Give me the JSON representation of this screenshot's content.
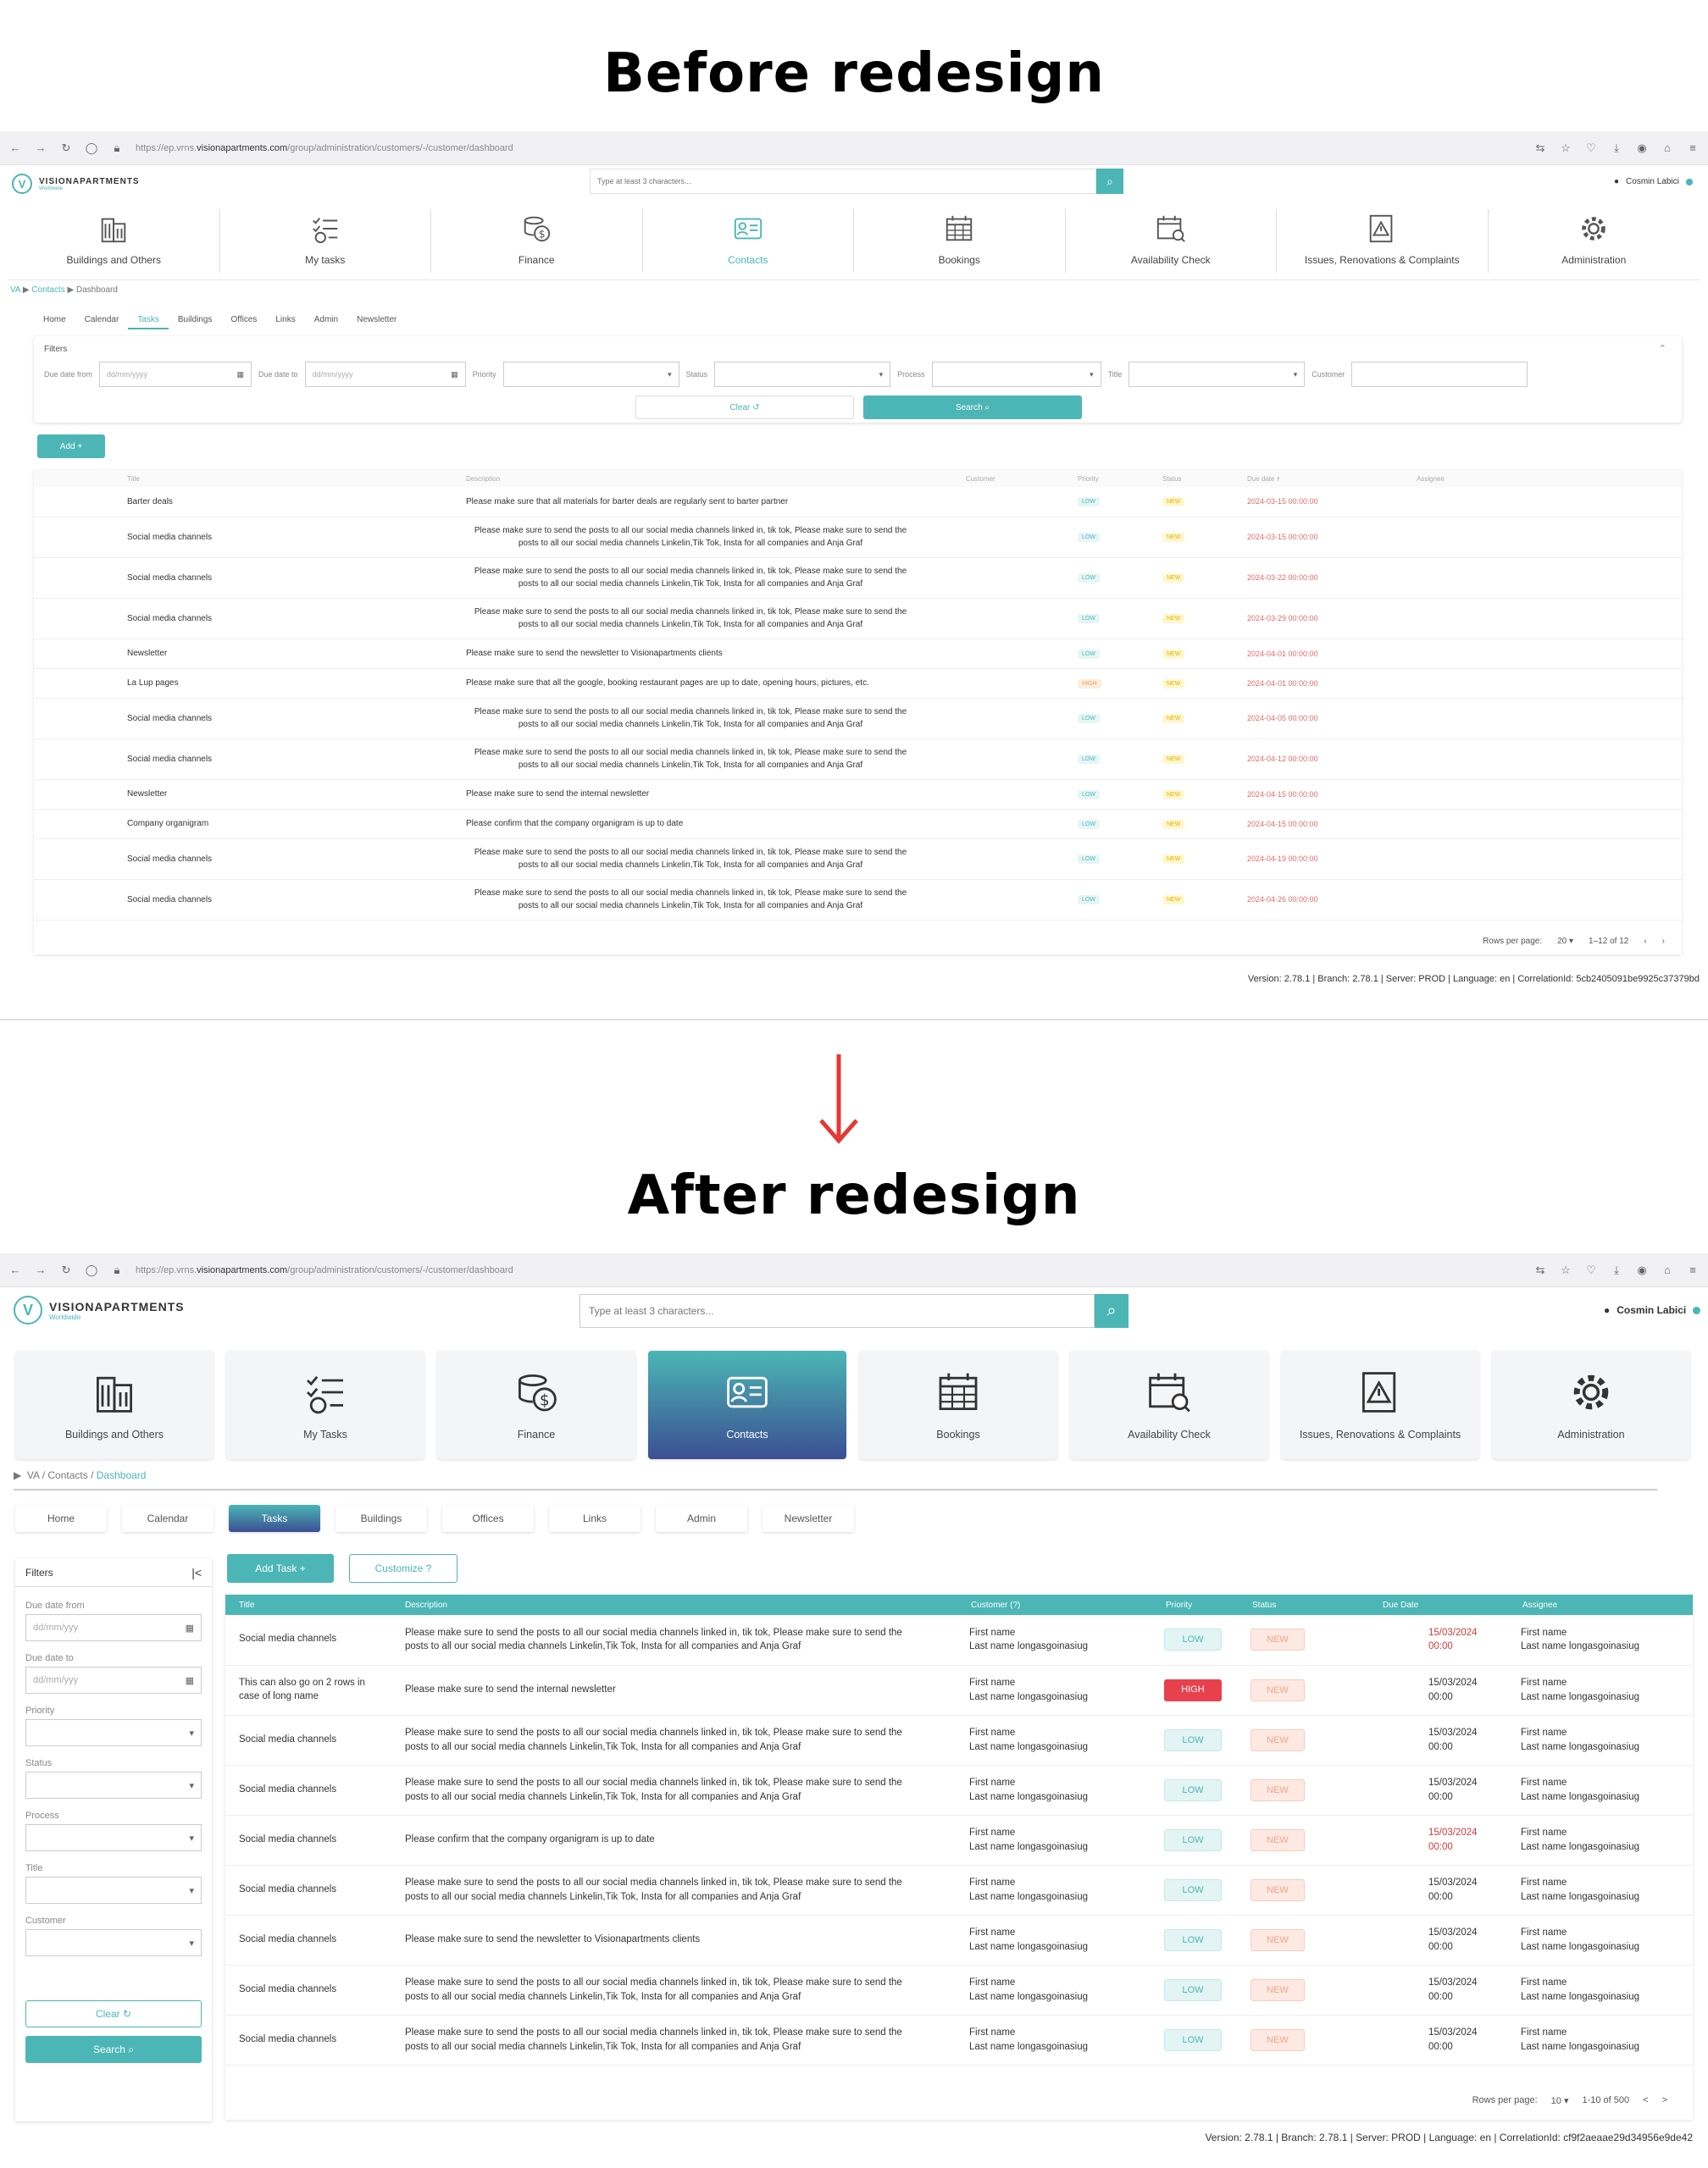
{
  "headings": {
    "before": "Before redesign",
    "after": "After redesign"
  },
  "browser": {
    "url_prefix": "https://ep.vrns.",
    "url_domain": "visionapartments.com",
    "url_path": "/group/administration/customers/-/customer/dashboard"
  },
  "brand": {
    "name": "VISIONAPARTMENTS",
    "sub": "Worldwide",
    "mark": "V"
  },
  "search": {
    "placeholder_old": "Type at least 3 characters...",
    "placeholder_new": "Type at least 3 characters..."
  },
  "user": {
    "name": "Cosmin Labici"
  },
  "nav": [
    {
      "label": "Buildings and Others",
      "icon": "building-icon"
    },
    {
      "label": "My tasks",
      "label_new": "My Tasks",
      "icon": "tasks-icon"
    },
    {
      "label": "Finance",
      "icon": "finance-icon"
    },
    {
      "label": "Contacts",
      "icon": "contacts-icon"
    },
    {
      "label": "Bookings",
      "icon": "bookings-icon"
    },
    {
      "label": "Availability Check",
      "icon": "calendar-check-icon"
    },
    {
      "label": "Issues, Renovations & Complaints",
      "icon": "issues-icon"
    },
    {
      "label": "Administration",
      "icon": "gear-icon"
    }
  ],
  "breadcrumb": {
    "root": "VA",
    "contacts": "Contacts",
    "current": "Dashboard"
  },
  "tabs": [
    "Home",
    "Calendar",
    "Tasks",
    "Buildings",
    "Offices",
    "Links",
    "Admin",
    "Newsletter"
  ],
  "old": {
    "filters": {
      "title": "Filters",
      "due_from": "Due date from",
      "due_to": "Due date to",
      "date_placeholder": "dd/mm/yyyy",
      "priority": "Priority",
      "status": "Status",
      "process": "Process",
      "title_f": "Title",
      "customer": "Customer",
      "clear": "Clear",
      "search": "Search"
    },
    "add": "Add",
    "columns": [
      "Title",
      "Description",
      "Customer",
      "Priority",
      "Status",
      "Due date",
      "Assignee"
    ],
    "rows": [
      {
        "title": "Barter deals",
        "desc": "Please make sure that all materials for barter deals are regularly sent to barter partner",
        "priority": "LOW",
        "status": "NEW",
        "due": "2024-03-15 00:00:00"
      },
      {
        "title": "Social media channels",
        "desc": "Please make sure to send the posts to all our social media channels linked in, tik tok, Please make sure to send the posts to all our social media channels Linkelin,Tik Tok, Insta for all companies and Anja Graf",
        "priority": "LOW",
        "status": "NEW",
        "due": "2024-03-15 00:00:00"
      },
      {
        "title": "Social media channels",
        "desc": "Please make sure to send the posts to all our social media channels linked in, tik tok, Please make sure to send the posts to all our social media channels Linkelin,Tik Tok, Insta for all companies and Anja Graf",
        "priority": "LOW",
        "status": "NEW",
        "due": "2024-03-22 00:00:00"
      },
      {
        "title": "Social media channels",
        "desc": "Please make sure to send the posts to all our social media channels linked in, tik tok, Please make sure to send the posts to all our social media channels Linkelin,Tik Tok, Insta for all companies and Anja Graf",
        "priority": "LOW",
        "status": "NEW",
        "due": "2024-03-29 00:00:00"
      },
      {
        "title": "Newsletter",
        "desc": "Please make sure to send the newsletter to Visionapartments clients",
        "priority": "LOW",
        "status": "NEW",
        "due": "2024-04-01 00:00:00"
      },
      {
        "title": "La Lup pages",
        "desc": "Please make sure that all the google, booking restaurant pages are up to date, opening hours, pictures, etc.",
        "priority": "HIGH",
        "status": "NEW",
        "due": "2024-04-01 00:00:00"
      },
      {
        "title": "Social media channels",
        "desc": "Please make sure to send the posts to all our social media channels linked in, tik tok, Please make sure to send the posts to all our social media channels Linkelin,Tik Tok, Insta for all companies and Anja Graf",
        "priority": "LOW",
        "status": "NEW",
        "due": "2024-04-05 00:00:00"
      },
      {
        "title": "Social media channels",
        "desc": "Please make sure to send the posts to all our social media channels linked in, tik tok, Please make sure to send the posts to all our social media channels Linkelin,Tik Tok, Insta for all companies and Anja Graf",
        "priority": "LOW",
        "status": "NEW",
        "due": "2024-04-12 00:00:00"
      },
      {
        "title": "Newsletter",
        "desc": "Please make sure to send the internal newsletter",
        "priority": "LOW",
        "status": "NEW",
        "due": "2024-04-15 00:00:00"
      },
      {
        "title": "Company organigram",
        "desc": "Please confirm that the company organigram is up to date",
        "priority": "LOW",
        "status": "NEW",
        "due": "2024-04-15 00:00:00"
      },
      {
        "title": "Social media channels",
        "desc": "Please make sure to send the posts to all our social media channels linked in, tik tok, Please make sure to send the posts to all our social media channels Linkelin,Tik Tok, Insta for all companies and Anja Graf",
        "priority": "LOW",
        "status": "NEW",
        "due": "2024-04-19 00:00:00"
      },
      {
        "title": "Social media channels",
        "desc": "Please make sure to send the posts to all our social media channels linked in, tik tok, Please make sure to send the posts to all our social media channels Linkelin,Tik Tok, Insta for all companies and Anja Graf",
        "priority": "LOW",
        "status": "NEW",
        "due": "2024-04-26 00:00:00"
      }
    ],
    "pagination": {
      "rows_label": "Rows per page:",
      "rows_value": "20",
      "range": "1–12 of 12"
    },
    "footer": "Version: 2.78.1  | Branch: 2.78.1  | Server: PROD  | Language: en  | CorrelationId: 5cb2405091be9925c37379bd"
  },
  "new": {
    "filters": {
      "title": "Filters",
      "due_from": "Due date from",
      "due_to": "Due date to",
      "date_placeholder": "dd/mm/yyy",
      "priority": "Priority",
      "status": "Status",
      "process": "Process",
      "title_f": "Title",
      "customer": "Customer",
      "clear": "Clear",
      "search": "Search"
    },
    "add_task": "Add Task",
    "customize": "Customize",
    "columns": [
      "Title",
      "Description",
      "Customer (?)",
      "Priority",
      "Status",
      "Due Date",
      "Assignee"
    ],
    "rows": [
      {
        "title": "Social media channels",
        "desc": "Please make sure to send the posts to all our social media channels  linked in, tik tok, Please make sure to send the posts to all our social  media channels Linkelin,Tik Tok, Insta for all companies and Anja Graf",
        "cust1": "First name",
        "cust2": "Last name longasgoinasiug",
        "priority": "LOW",
        "status": "NEW",
        "due1": "15/03/2024",
        "due2": "00:00",
        "red": true,
        "as1": "First name",
        "as2": "Last name longasgoinasiug"
      },
      {
        "title": "This can also go on 2 rows in case of long name",
        "desc": "Please make sure to send the internal newsletter",
        "cust1": "First name",
        "cust2": "Last name longasgoinasiug",
        "priority": "HIGH",
        "status": "NEW",
        "due1": "15/03/2024",
        "due2": "00:00",
        "red": false,
        "as1": "First name",
        "as2": "Last name longasgoinasiug"
      },
      {
        "title": "Social media channels",
        "desc": "Please make sure to send the posts to all our social media channels  linked in, tik tok, Please make sure to send the posts to all our social  media channels Linkelin,Tik Tok, Insta for all companies and Anja Graf",
        "cust1": "First name",
        "cust2": "Last name longasgoinasiug",
        "priority": "LOW",
        "status": "NEW",
        "due1": "15/03/2024",
        "due2": "00:00",
        "red": false,
        "as1": "First name",
        "as2": "Last name longasgoinasiug"
      },
      {
        "title": "Social media channels",
        "desc": "Please make sure to send the posts to all our social media channels  linked in, tik tok, Please make sure to send the posts to all our social  media channels Linkelin,Tik Tok, Insta for all companies and Anja Graf",
        "cust1": "First name",
        "cust2": "Last name longasgoinasiug",
        "priority": "LOW",
        "status": "NEW",
        "due1": "15/03/2024",
        "due2": "00:00",
        "red": false,
        "as1": "First name",
        "as2": "Last name longasgoinasiug"
      },
      {
        "title": "Social media channels",
        "desc": "Please confirm that the company organigram is up to date",
        "cust1": "First name",
        "cust2": "Last name longasgoinasiug",
        "priority": "LOW",
        "status": "NEW",
        "due1": "15/03/2024",
        "due2": "00:00",
        "red": true,
        "as1": "First name",
        "as2": "Last name longasgoinasiug"
      },
      {
        "title": "Social media channels",
        "desc": "Please make sure to send the posts to all our social media channels  linked in, tik tok, Please make sure to send the posts to all our social  media channels Linkelin,Tik Tok, Insta for all companies and Anja Graf",
        "cust1": "First name",
        "cust2": "Last name longasgoinasiug",
        "priority": "LOW",
        "status": "NEW",
        "due1": "15/03/2024",
        "due2": "00:00",
        "red": false,
        "as1": "First name",
        "as2": "Last name longasgoinasiug"
      },
      {
        "title": "Social media channels",
        "desc": "Please make sure to send the newsletter to Visionapartments clients",
        "cust1": "First name",
        "cust2": "Last name longasgoinasiug",
        "priority": "LOW",
        "status": "NEW",
        "due1": "15/03/2024",
        "due2": "00:00",
        "red": false,
        "as1": "First name",
        "as2": "Last name longasgoinasiug"
      },
      {
        "title": "Social media channels",
        "desc": "Please make sure to send the posts to all our social media channels  linked in, tik tok, Please make sure to send the posts to all our social  media channels Linkelin,Tik Tok, Insta for all companies and Anja Graf",
        "cust1": "First name",
        "cust2": "Last name longasgoinasiug",
        "priority": "LOW",
        "status": "NEW",
        "due1": "15/03/2024",
        "due2": "00:00",
        "red": false,
        "as1": "First name",
        "as2": "Last name longasgoinasiug"
      },
      {
        "title": "Social media channels",
        "desc": "Please make sure to send the posts to all our social media channels  linked in, tik tok, Please make sure to send the posts to all our social  media channels Linkelin,Tik Tok, Insta for all companies and Anja Graf",
        "cust1": "First name",
        "cust2": "Last name longasgoinasiug",
        "priority": "LOW",
        "status": "NEW",
        "due1": "15/03/2024",
        "due2": "00:00",
        "red": false,
        "as1": "First name",
        "as2": "Last name longasgoinasiug"
      }
    ],
    "pagination": {
      "rows_label": "Rows per page:",
      "rows_value": "10",
      "range": "1-10 of 500"
    },
    "footer": "Version: 2.78.1  |  Branch: 2.78.1  |  Server: PROD  |  Language: en  |  CorrelationId: cf9f2aeaae29d34956e9de42"
  },
  "colors": {
    "teal": "#4bb6b5",
    "navy": "#3b4f93",
    "red": "#e8414d",
    "arrow": "#e53935"
  }
}
